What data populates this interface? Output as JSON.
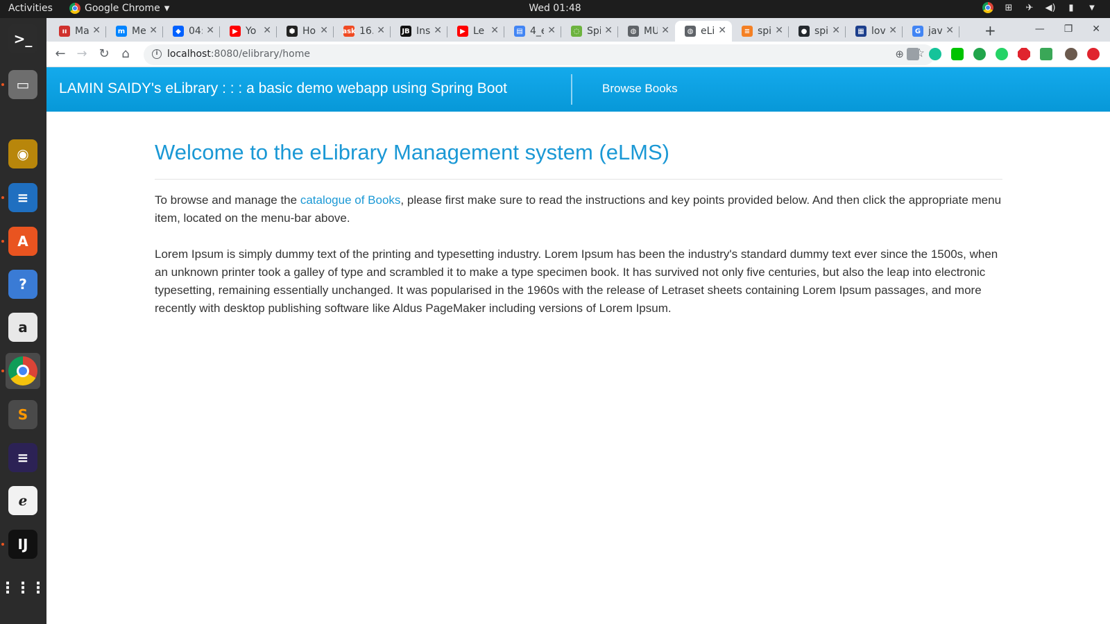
{
  "system_bar": {
    "activities": "Activities",
    "app_name": "Google Chrome",
    "clock": "Wed 01:48"
  },
  "dock": {
    "apps": [
      {
        "name": "terminal",
        "glyph": ">_",
        "color": "#2c2c2c"
      },
      {
        "name": "files",
        "glyph": "▭",
        "color": "#6e6e6e"
      },
      {
        "name": "rhythmbox",
        "glyph": "◉",
        "color": "#b8860b"
      },
      {
        "name": "writer",
        "glyph": "≡",
        "color": "#1f6fc0"
      },
      {
        "name": "software",
        "glyph": "A",
        "color": "#e95420"
      },
      {
        "name": "help",
        "glyph": "?",
        "color": "#3a7bd5"
      },
      {
        "name": "amazon",
        "glyph": "a",
        "color": "#e8e8e8"
      },
      {
        "name": "chrome",
        "glyph": "",
        "color": "#4285f4"
      },
      {
        "name": "sublime",
        "glyph": "S",
        "color": "#4a4a4a"
      },
      {
        "name": "eclipse",
        "glyph": "≡",
        "color": "#2c2255"
      },
      {
        "name": "acrobat",
        "glyph": "ℯ",
        "color": "#f2f2f2"
      },
      {
        "name": "intellij",
        "glyph": "IJ",
        "color": "#111111"
      },
      {
        "name": "app-grid",
        "glyph": "⋮⋮",
        "color": "#2b2b2b"
      }
    ]
  },
  "browser": {
    "tabs": [
      {
        "title": "Ma",
        "color": "#d0312d",
        "glyph": "ıı"
      },
      {
        "title": "Me",
        "color": "#0084ff",
        "glyph": "m"
      },
      {
        "title": "04:",
        "color": "#0061ff",
        "glyph": "◆"
      },
      {
        "title": "Yo",
        "color": "#ff0000",
        "glyph": "▶"
      },
      {
        "title": "Ho",
        "color": "#222222",
        "glyph": "⬢"
      },
      {
        "title": "16.",
        "color": "#f04a23",
        "glyph": "ask"
      },
      {
        "title": "Ins",
        "color": "#111111",
        "glyph": "JB"
      },
      {
        "title": "Le",
        "color": "#ff0000",
        "glyph": "▶"
      },
      {
        "title": "4_e",
        "color": "#4285f4",
        "glyph": "▤"
      },
      {
        "title": "Spi",
        "color": "#6db33f",
        "glyph": "◌"
      },
      {
        "title": "MU",
        "color": "#5f6368",
        "glyph": "◍"
      },
      {
        "title": "eLi",
        "color": "#5f6368",
        "glyph": "◍"
      },
      {
        "title": "spi",
        "color": "#f48024",
        "glyph": "≡"
      },
      {
        "title": "spi",
        "color": "#24292e",
        "glyph": "●"
      },
      {
        "title": "lov",
        "color": "#1d3f8c",
        "glyph": "▦"
      },
      {
        "title": "jav",
        "color": "#4285f4",
        "glyph": "G"
      }
    ],
    "active_tab_index": 11,
    "url_host": "localhost",
    "url_path": ":8080/elibrary/home"
  },
  "site": {
    "brand": "LAMIN SAIDY's eLibrary : : : a basic demo webapp using Spring Boot",
    "nav_browse": "Browse Books",
    "heading": "Welcome to the eLibrary Management system (eLMS)",
    "intro_before_link": "To browse and manage the ",
    "intro_link": "catalogue of Books",
    "intro_after_link": ", please first make sure to read the instructions and key points provided below. And then click the appropriate menu item, located on the menu-bar above.",
    "lorem": "Lorem Ipsum is simply dummy text of the printing and typesetting industry. Lorem Ipsum has been the industry's standard dummy text ever since the 1500s, when an unknown printer took a galley of type and scrambled it to make a type specimen book. It has survived not only five centuries, but also the leap into electronic typesetting, remaining essentially unchanged. It was popularised in the 1960s with the release of Letraset sheets containing Lorem Ipsum passages, and more recently with desktop publishing software like Aldus PageMaker including versions of Lorem Ipsum."
  }
}
